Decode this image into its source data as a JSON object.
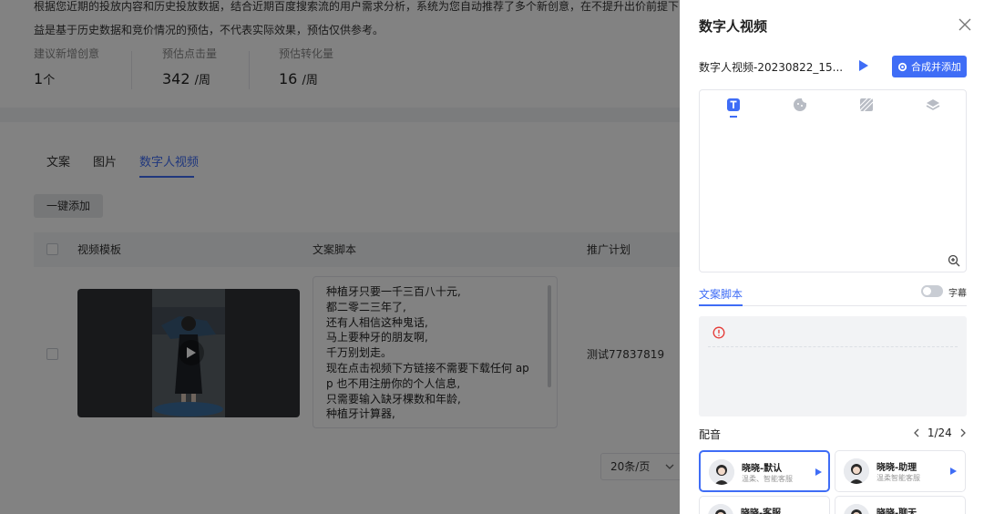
{
  "background": {
    "description_lines": [
      "根据您近期的投放内容和历史投放数据，结合近期百度搜索流的用户需求分析，系统为您自动推荐了多个新创意，在不提升出价前提下",
      "益是基于历史数据和竞价情况的预估，不代表实际效果，预估仅供参考。"
    ],
    "stats": [
      {
        "label": "建议新增创意",
        "value": "1",
        "unit": "个"
      },
      {
        "label": "预估点击量",
        "value": "342",
        "unit": "/周"
      },
      {
        "label": "预估转化量",
        "value": "16",
        "unit": "/周"
      }
    ],
    "tabs": [
      "文案",
      "图片",
      "数字人视频"
    ],
    "active_tab": "数字人视频",
    "add_all_label": "一键添加",
    "table_headers": [
      "视频模板",
      "文案脚本",
      "推广计划"
    ],
    "script_lines": [
      "种植牙只要一千三百八十元,",
      "都二零二三年了,",
      "还有人相信这种鬼话,",
      "马上要种牙的朋友啊,",
      "千万别划走。",
      "现在点击视频下方链接不需要下载任何 ap",
      "p 也不用注册你的个人信息,",
      "只需要输入缺牙棵数和年龄,",
      "种植牙计算器,"
    ],
    "plan_name": "测试77837819",
    "page_size": "20条/页"
  },
  "drawer": {
    "title": "数字人视频",
    "file_name": "数字人视频-20230822_15...",
    "combine_label": "合成并添加",
    "script_tab": "文案脚本",
    "subtitle_label": "字幕",
    "dubbing_label": "配音",
    "page_indicator": "1/24",
    "voices": [
      {
        "name": "晓晓-默认",
        "tags": "温柔、智能客服",
        "selected": true
      },
      {
        "name": "晓晓-助理",
        "tags": "温柔智能客服",
        "selected": false
      },
      {
        "name": "晓晓-客服",
        "tags": "",
        "selected": false
      },
      {
        "name": "晓晓-聊天",
        "tags": "",
        "selected": false
      }
    ],
    "tools": [
      "text-tool-icon",
      "sticker-tool-icon",
      "background-tool-icon",
      "layer-tool-icon"
    ]
  },
  "colors": {
    "accent": "#3f6df6",
    "overlay": "rgba(0,0,0,0.49)",
    "warn": "#e53935"
  }
}
